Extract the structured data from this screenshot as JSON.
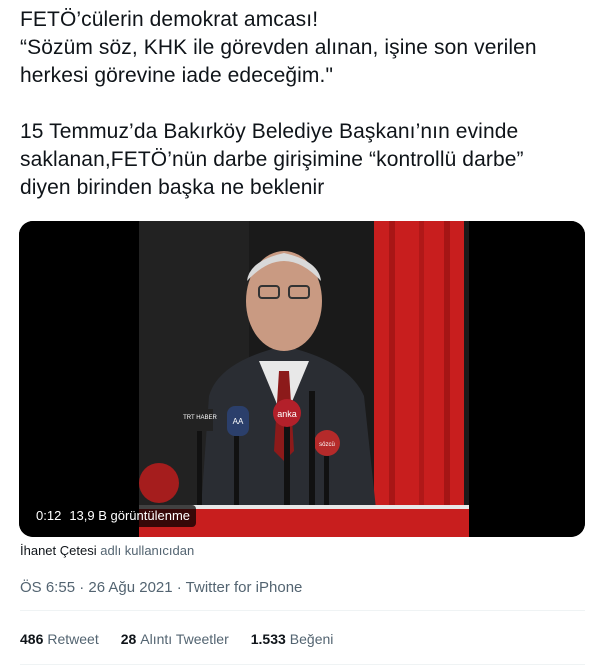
{
  "tweet": {
    "lines": [
      "FETÖ’cülerin demokrat amcası!",
      "“Sözüm söz, KHK ile görevden alınan, işine son verilen",
      "herkesi görevine iade edeceğim.\"",
      "15 Temmuz’da Bakırköy Belediye Başkanı’nın evinde",
      "saklanan,FETÖ’nün darbe girişimine “kontrollü darbe”",
      "diyen birinden başka ne beklenir"
    ]
  },
  "video": {
    "duration": "0:12",
    "views": "13,9 B görüntülenme",
    "mic_labels": [
      "anka",
      "TRT HABER",
      "AA",
      "sözcü"
    ]
  },
  "attribution": {
    "author": "İhanet Çetesi",
    "suffix": "adlı kullanıcıdan"
  },
  "meta": {
    "timestamp": "ÖS 6:55 · 26 Ağu 2021 · Twitter for iPhone"
  },
  "stats": {
    "retweets": {
      "count": "486",
      "label": "Retweet"
    },
    "quotes": {
      "count": "28",
      "label": "Alıntı Tweetler"
    },
    "likes": {
      "count": "1.533",
      "label": "Beğeni"
    }
  },
  "colors": {
    "text": "#0f1419",
    "secondary": "#536471",
    "curtain_red": "#c81e1e"
  }
}
